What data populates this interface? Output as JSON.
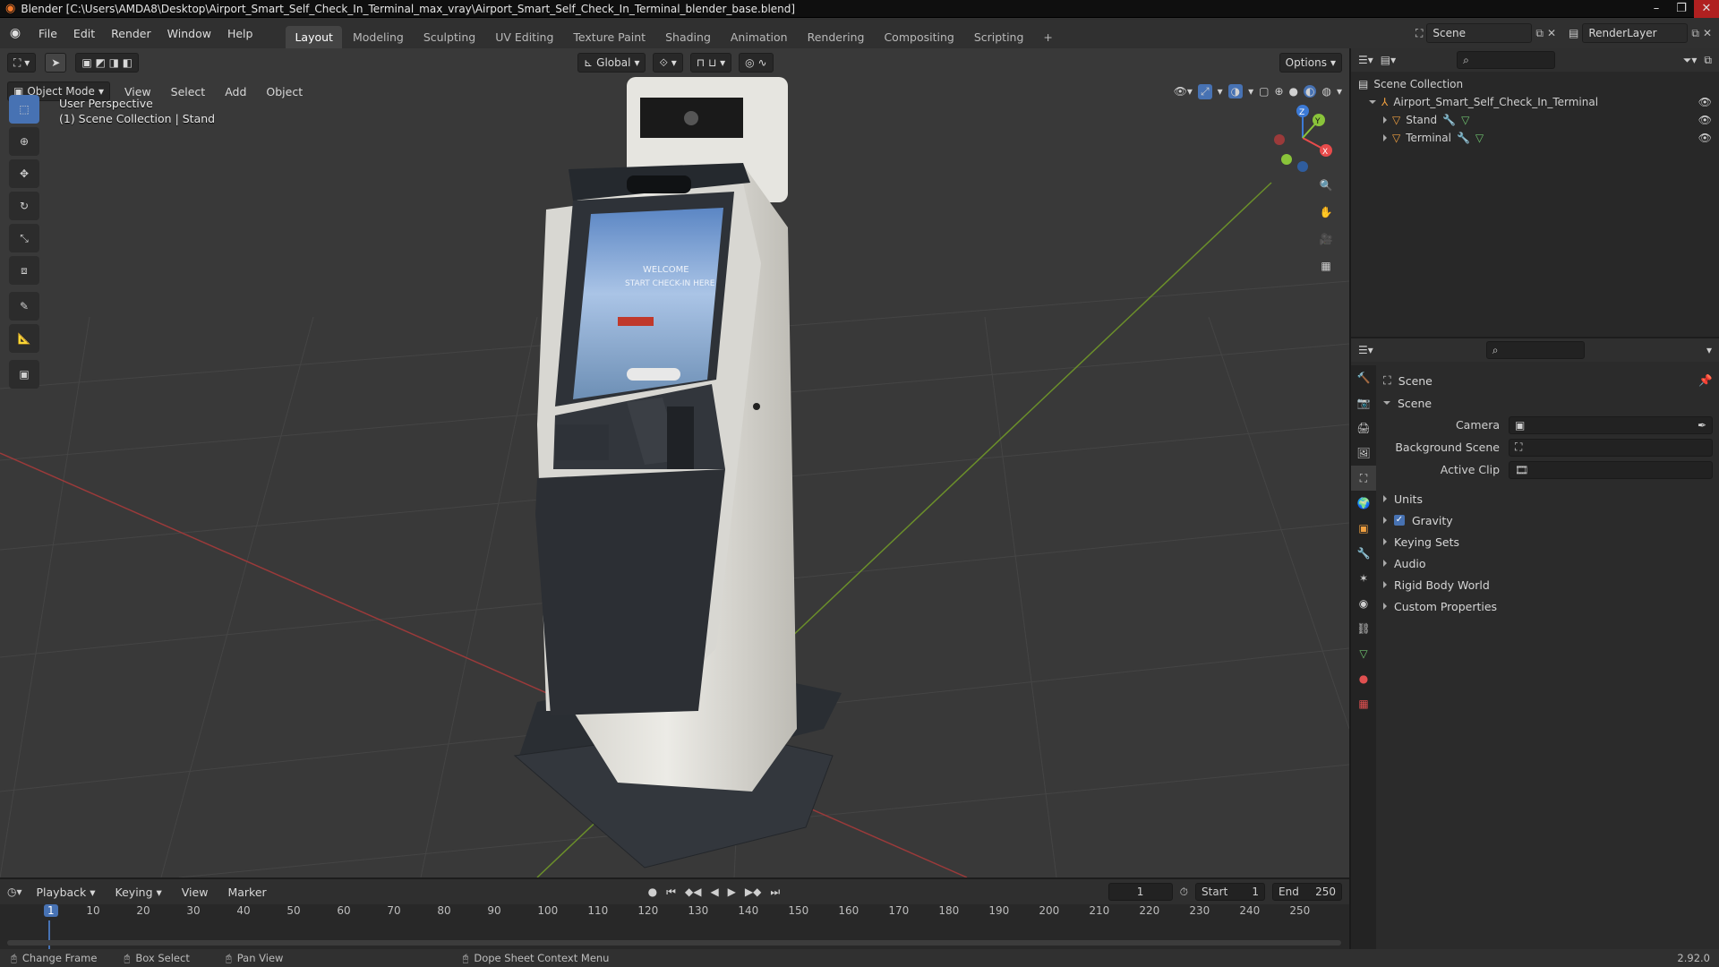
{
  "window": {
    "title": "Blender [C:\\Users\\AMDA8\\Desktop\\Airport_Smart_Self_Check_In_Terminal_max_vray\\Airport_Smart_Self_Check_In_Terminal_blender_base.blend]"
  },
  "menu": [
    "File",
    "Edit",
    "Render",
    "Window",
    "Help"
  ],
  "workspaces": [
    "Layout",
    "Modeling",
    "Sculpting",
    "UV Editing",
    "Texture Paint",
    "Shading",
    "Animation",
    "Rendering",
    "Compositing",
    "Scripting"
  ],
  "scene_selector": {
    "scene": "Scene",
    "view_layer": "RenderLayer"
  },
  "viewport": {
    "transform_orientation": "Global",
    "options_label": "Options",
    "mode": "Object Mode",
    "header_menus": [
      "View",
      "Select",
      "Add",
      "Object"
    ],
    "perspective_text": "User Perspective",
    "collection_text": "(1) Scene Collection | Stand",
    "axis_labels": {
      "z": "Z",
      "y": "Y",
      "x": "X"
    },
    "screen_text": {
      "line1": "WELCOME",
      "line2": "START CHECK-IN HERE"
    }
  },
  "outliner": {
    "root": "Scene Collection",
    "items": [
      {
        "name": "Airport_Smart_Self_Check_In_Terminal",
        "level": 1
      },
      {
        "name": "Stand",
        "level": 2
      },
      {
        "name": "Terminal",
        "level": 2
      }
    ]
  },
  "properties": {
    "context": "Scene",
    "section": "Scene",
    "fields": [
      {
        "label": "Camera"
      },
      {
        "label": "Background Scene"
      },
      {
        "label": "Active Clip"
      }
    ],
    "panels": [
      {
        "label": "Units",
        "checkbox": false
      },
      {
        "label": "Gravity",
        "checkbox": true
      },
      {
        "label": "Keying Sets",
        "checkbox": false
      },
      {
        "label": "Audio",
        "checkbox": false
      },
      {
        "label": "Rigid Body World",
        "checkbox": false
      },
      {
        "label": "Custom Properties",
        "checkbox": false
      }
    ]
  },
  "timeline": {
    "menus": [
      "Playback",
      "Keying",
      "View",
      "Marker"
    ],
    "current_frame": "1",
    "start_label": "Start",
    "start": "1",
    "end_label": "End",
    "end": "250",
    "ruler": [
      "1",
      "10",
      "20",
      "30",
      "40",
      "50",
      "60",
      "70",
      "80",
      "90",
      "100",
      "110",
      "120",
      "130",
      "140",
      "150",
      "160",
      "170",
      "180",
      "190",
      "200",
      "210",
      "220",
      "230",
      "240",
      "250"
    ]
  },
  "statusbar": {
    "items": [
      "Change Frame",
      "Box Select",
      "Pan View",
      "Dope Sheet Context Menu"
    ],
    "version": "2.92.0"
  },
  "colors": {
    "accent": "#4772b3",
    "bg": "#393939",
    "x_axis": "#e84b4b",
    "y_axis": "#8ac43a",
    "z_axis": "#3c7ad6"
  }
}
